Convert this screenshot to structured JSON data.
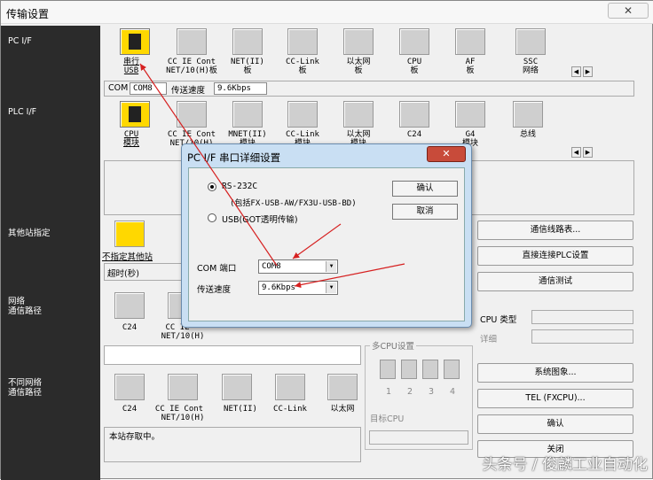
{
  "window": {
    "title": "传输设置",
    "close_symbol": "✕"
  },
  "sidebar": {
    "pc_if": "PC I/F",
    "plc_if": "PLC I/F",
    "other_station": "其他站指定",
    "network_route": [
      "网络",
      "通信路径"
    ],
    "diff_network_route": [
      "不同网络",
      "通信路径"
    ]
  },
  "pc_if_icons": [
    {
      "line1": "串行",
      "line2": "USB"
    },
    {
      "line1": "CC IE Cont",
      "line2": "NET/10(H)板"
    },
    {
      "line1": "NET(II)",
      "line2": "板"
    },
    {
      "line1": "CC-Link",
      "line2": "板"
    },
    {
      "line1": "以太网",
      "line2": "板"
    },
    {
      "line1": "CPU",
      "line2": "板"
    },
    {
      "line1": "AF",
      "line2": "板"
    },
    {
      "line1": "SSC",
      "line2": "网络"
    }
  ],
  "pc_status": {
    "com_label": "COM",
    "com_value": "COM8",
    "speed_label": "传送速度",
    "speed_value": "9.6Kbps"
  },
  "plc_if_icons": [
    {
      "line1": "CPU",
      "line2": "模块"
    },
    {
      "line1": "CC IE Cont",
      "line2": "NET/10(H)"
    },
    {
      "line1": "MNET(II)",
      "line2": "模块"
    },
    {
      "line1": "CC-Link",
      "line2": "模块"
    },
    {
      "line1": "以太网",
      "line2": "模块"
    },
    {
      "line1": "C24",
      "line2": ""
    },
    {
      "line1": "G4",
      "line2": "模块"
    },
    {
      "line1": "总线",
      "line2": ""
    }
  ],
  "other_station": {
    "label": "不指定其他站",
    "timeout_label": "超时(秒)"
  },
  "network_icons": [
    {
      "line1": "C24",
      "line2": ""
    },
    {
      "line1": "CC IE",
      "line2": "NET/10(H)"
    }
  ],
  "diff_network_icons": [
    {
      "line1": "C24",
      "line2": ""
    },
    {
      "line1": "CC IE Cont",
      "line2": "NET/10(H)"
    },
    {
      "line1": "NET(II)",
      "line2": ""
    },
    {
      "line1": "CC-Link",
      "line2": ""
    },
    {
      "line1": "以太网",
      "line2": ""
    }
  ],
  "multi_cpu": {
    "title": "多CPU设置",
    "nums": [
      "1",
      "2",
      "3",
      "4"
    ],
    "target_label": "目标CPU"
  },
  "status_text": "本站存取中。",
  "right_buttons": {
    "route_table": "通信线路表...",
    "direct_plc": "直接连接PLC设置",
    "comm_test": "通信测试",
    "cpu_type_label": "CPU 类型",
    "detail_label": "详细",
    "system_image": "系统图象...",
    "tel": "TEL (FXCPU)...",
    "ok": "确认",
    "close": "关闭"
  },
  "dialog": {
    "title": "PC I/F 串口详细设置",
    "close_symbol": "✕",
    "rs232c_label": "RS-232C",
    "rs232c_note": "(包括FX-USB-AW/FX3U-USB-BD)",
    "usb_label": "USB(GOT透明传输)",
    "ok": "确认",
    "cancel": "取消",
    "com_port_label": "COM 端口",
    "com_port_value": "COM8",
    "speed_label": "传送速度",
    "speed_value": "9.6Kbps"
  },
  "scroll": {
    "left": "◀",
    "right": "▶",
    "down": "▼"
  },
  "watermark": "头条号 / 俊麟工业自动化",
  "colors": {
    "sidebar_bg": "#2b2b2b",
    "active_icon": "#ffd800",
    "dialog_frame": "#c9dff3",
    "dialog_close": "#c84b3a",
    "arrow": "#d62020"
  }
}
